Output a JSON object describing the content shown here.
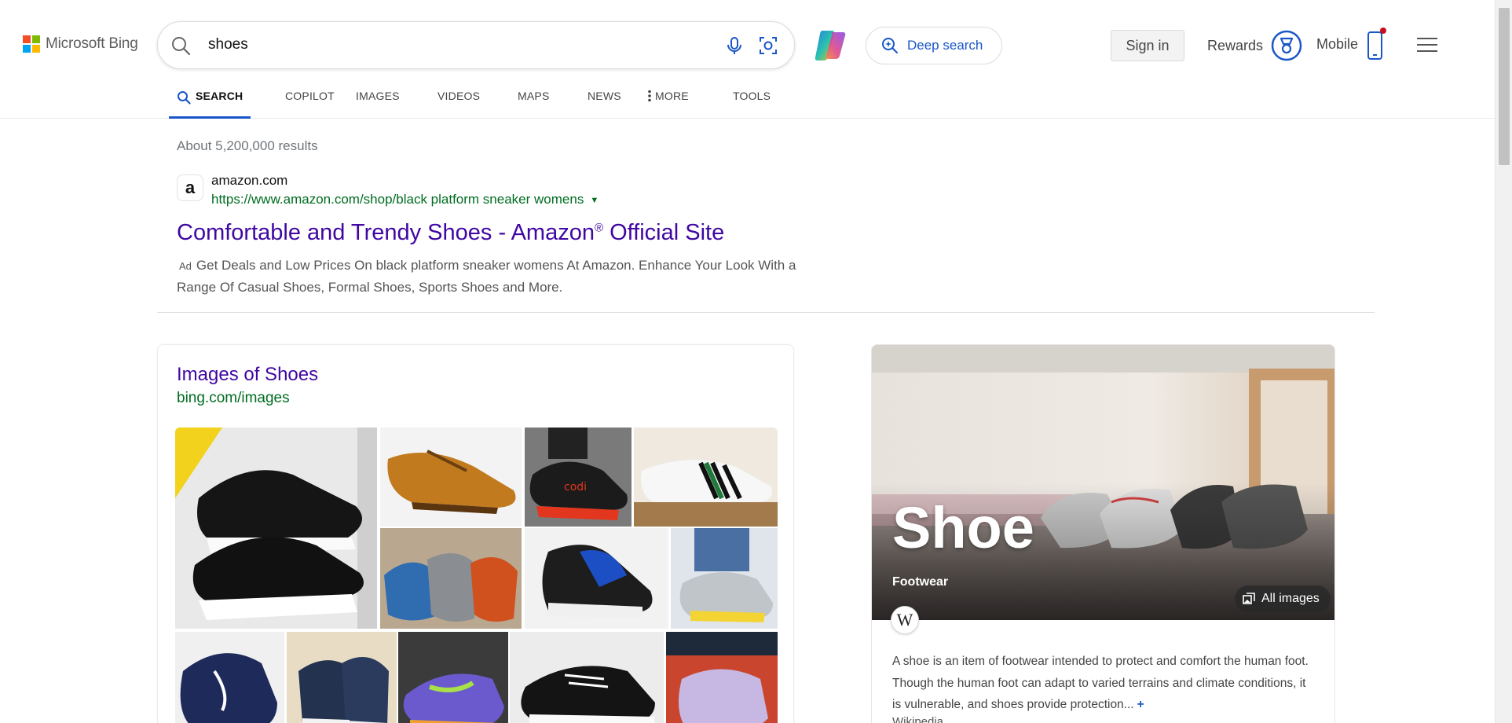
{
  "brand": {
    "name": "Microsoft Bing",
    "colors": [
      "#f25022",
      "#7fba00",
      "#00a4ef",
      "#ffb900"
    ]
  },
  "search": {
    "query": "shoes"
  },
  "header": {
    "deep_search": "Deep search",
    "sign_in": "Sign in",
    "rewards": "Rewards",
    "mobile": "Mobile"
  },
  "nav": {
    "items": [
      {
        "label": "SEARCH",
        "active": true
      },
      {
        "label": "COPILOT"
      },
      {
        "label": "IMAGES"
      },
      {
        "label": "VIDEOS"
      },
      {
        "label": "MAPS"
      },
      {
        "label": "NEWS"
      },
      {
        "label": "MORE"
      },
      {
        "label": "TOOLS"
      }
    ]
  },
  "results": {
    "count": "About 5,200,000 results",
    "ad": {
      "favicon": "a",
      "site": "amazon.com",
      "url": "https://www.amazon.com/shop/black platform sneaker womens",
      "title": "Comfortable and Trendy Shoes - Amazon",
      "title_mark": "®",
      "title_suffix": " Official Site",
      "badge": "Ad",
      "description": "Get Deals and Low Prices On black platform sneaker womens At Amazon. Enhance Your Look With a Range Of Casual Shoes, Formal Shoes, Sports Shoes and More."
    }
  },
  "images_card": {
    "title": "Images of Shoes",
    "url": "bing.com/images"
  },
  "knowledge_panel": {
    "title": "Shoe",
    "subtitle": "Footwear",
    "all_images": "All images",
    "wiki_letter": "W",
    "description": "A shoe is an item of footwear intended to protect and comfort the human foot. Though the human foot can adapt to varied terrains and climate conditions, it is vulnerable, and shoes provide protection...",
    "more": "+",
    "source": "Wikipedia"
  }
}
